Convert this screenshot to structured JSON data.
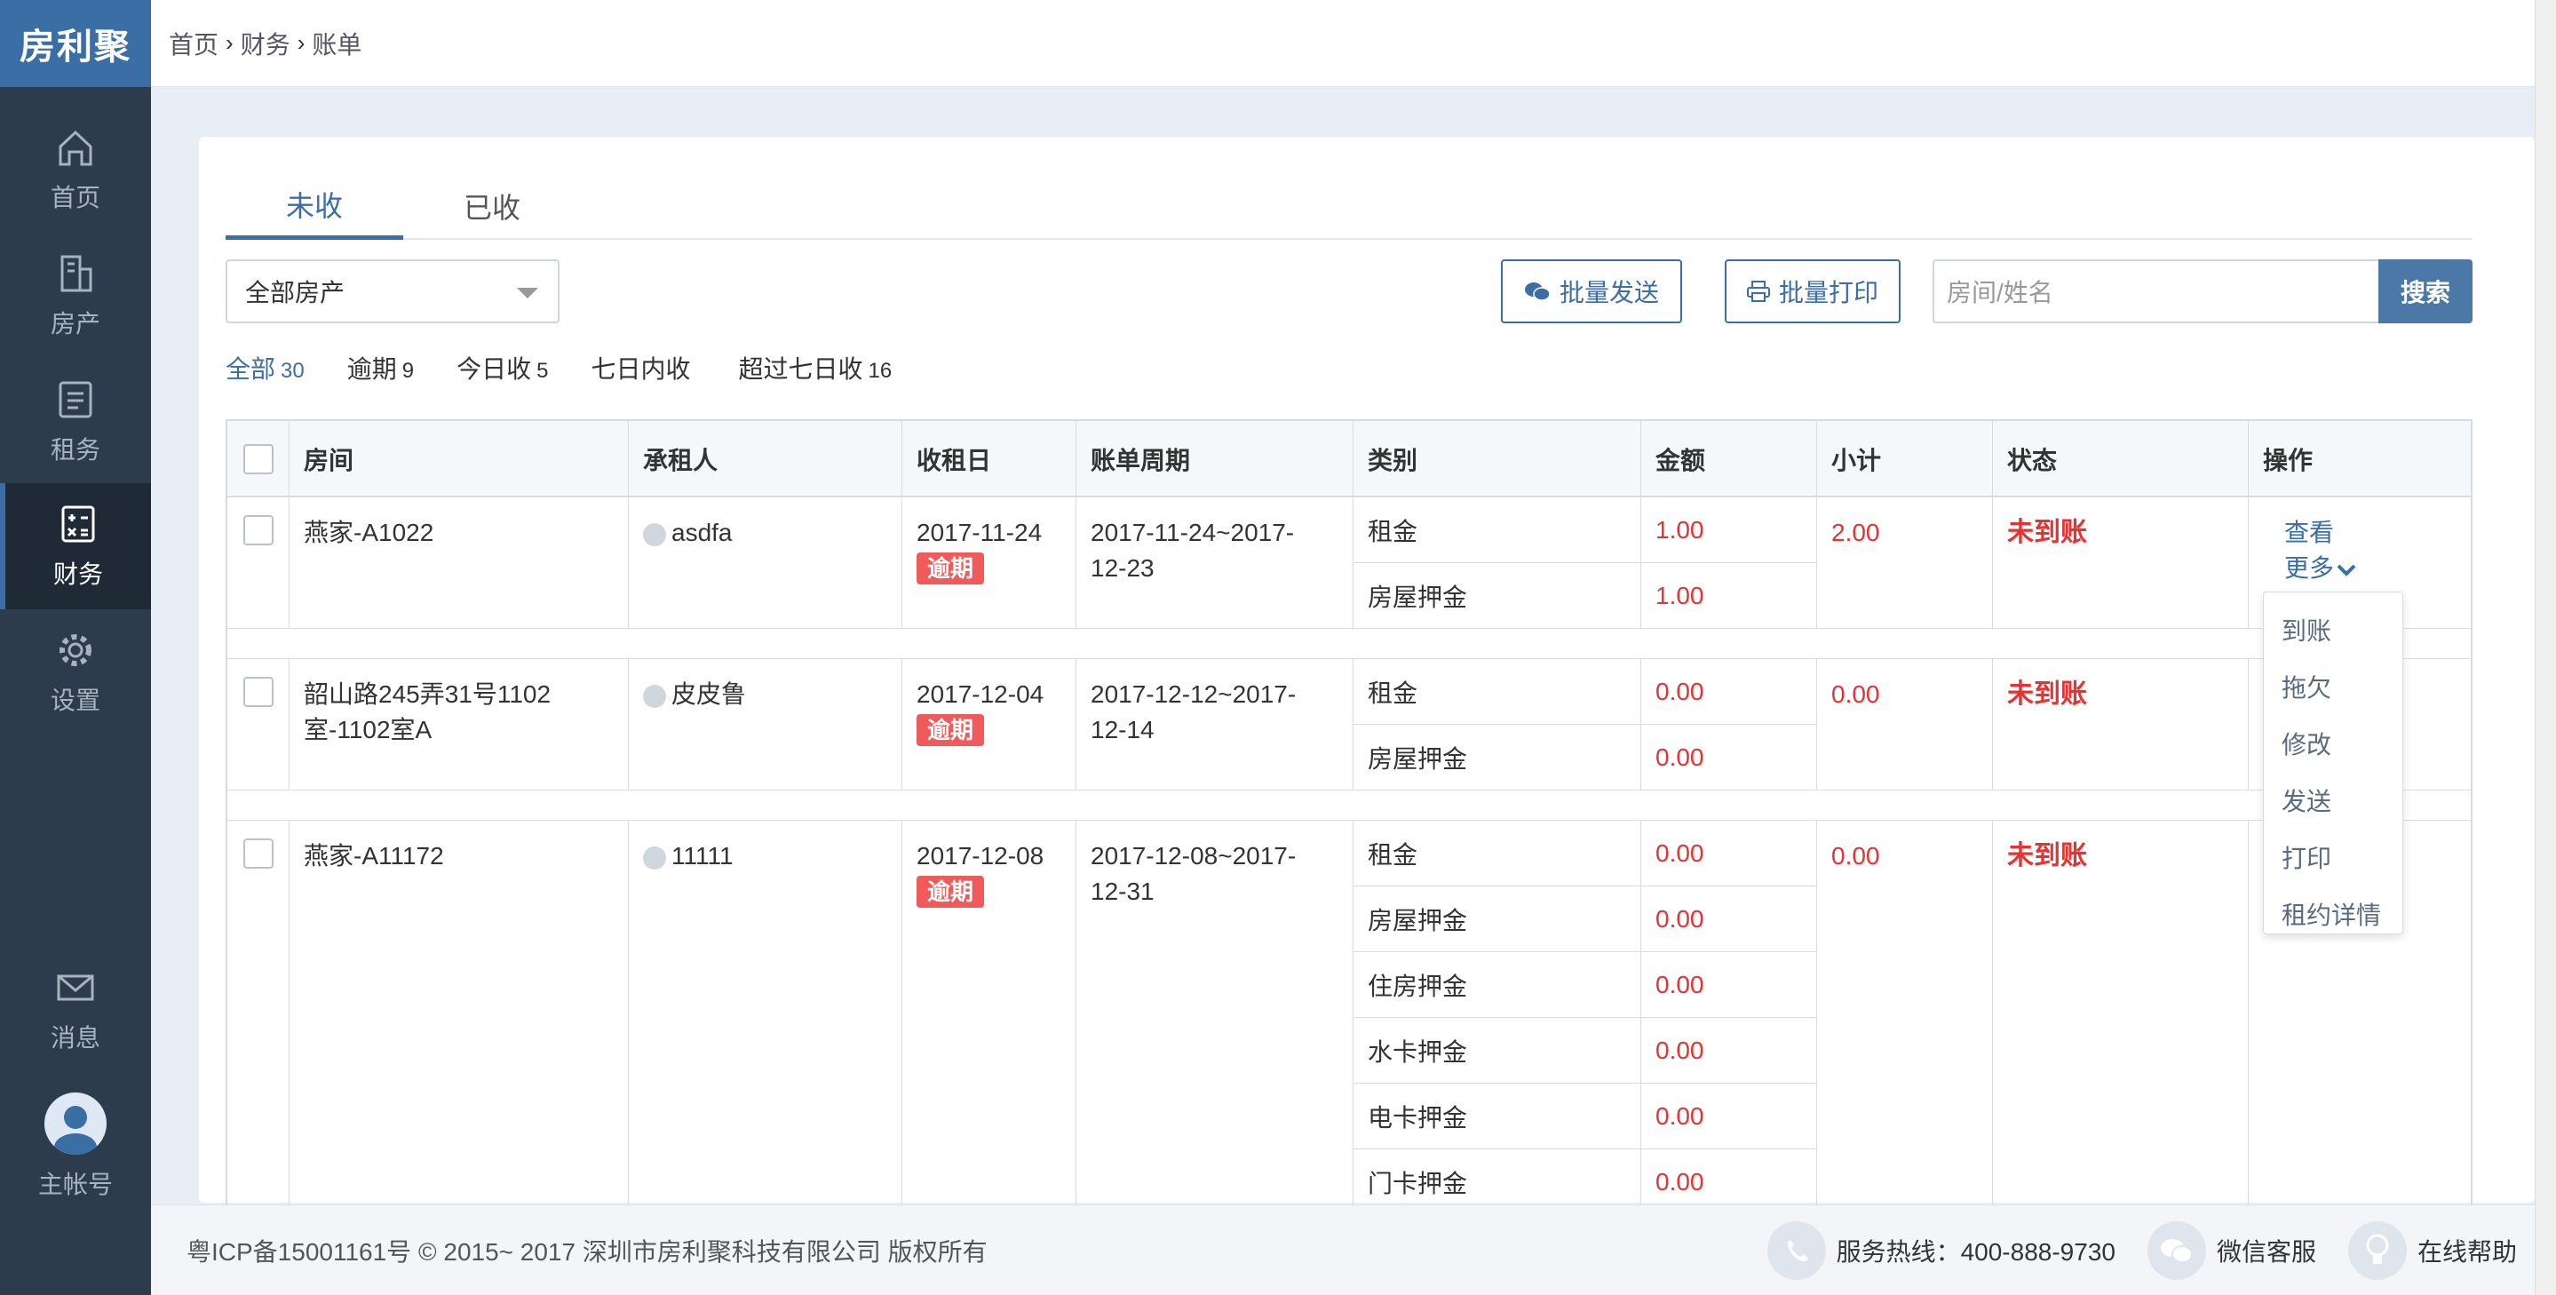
{
  "app": {
    "logo": "房利聚"
  },
  "breadcrumb": [
    "首页",
    "财务",
    "账单"
  ],
  "sidebar": {
    "items": [
      {
        "label": "首页",
        "icon": "home-icon"
      },
      {
        "label": "房产",
        "icon": "building-icon"
      },
      {
        "label": "租务",
        "icon": "lease-icon"
      },
      {
        "label": "财务",
        "icon": "finance-icon",
        "active": true
      },
      {
        "label": "设置",
        "icon": "gear-icon"
      },
      {
        "label": "消息",
        "icon": "mail-icon"
      },
      {
        "label": "主帐号",
        "icon": "avatar-icon"
      }
    ]
  },
  "tabs": [
    {
      "label": "未收",
      "active": true
    },
    {
      "label": "已收"
    }
  ],
  "property_select": {
    "value": "全部房产"
  },
  "toolbar": {
    "batch_send": "批量发送",
    "batch_print": "批量打印",
    "search_placeholder": "房间/姓名",
    "search_button": "搜索"
  },
  "filters": [
    {
      "label": "全部",
      "count": "30",
      "active": true
    },
    {
      "label": "逾期",
      "count": "9"
    },
    {
      "label": "今日收",
      "count": "5"
    },
    {
      "label": "七日内收",
      "count": ""
    },
    {
      "label": "超过七日收",
      "count": "16"
    }
  ],
  "table": {
    "headers": [
      "房间",
      "承租人",
      "收租日",
      "账单周期",
      "类别",
      "金额",
      "小计",
      "状态",
      "操作"
    ],
    "rows": [
      {
        "room_line1": "燕家-A1022",
        "room_line2": "",
        "tenant": "asdfa",
        "due_date": "2017-11-24",
        "overdue": "逾期",
        "period_line1": "2017-11-24~2017-",
        "period_line2": "12-23",
        "items": [
          {
            "type": "租金",
            "amount": "1.00"
          },
          {
            "type": "房屋押金",
            "amount": "1.00"
          }
        ],
        "subtotal": "2.00",
        "status": "未到账",
        "ops": {
          "view": "查看",
          "more": "更多"
        }
      },
      {
        "room_line1": "韶山路245弄31号1102",
        "room_line2": "室-1102室A",
        "tenant": "皮皮鲁",
        "due_date": "2017-12-04",
        "overdue": "逾期",
        "period_line1": "2017-12-12~2017-",
        "period_line2": "12-14",
        "items": [
          {
            "type": "租金",
            "amount": "0.00"
          },
          {
            "type": "房屋押金",
            "amount": "0.00"
          }
        ],
        "subtotal": "0.00",
        "status": "未到账"
      },
      {
        "room_line1": "燕家-A11172",
        "room_line2": "",
        "tenant": "11111",
        "due_date": "2017-12-08",
        "overdue": "逾期",
        "period_line1": "2017-12-08~2017-",
        "period_line2": "12-31",
        "items": [
          {
            "type": "租金",
            "amount": "0.00"
          },
          {
            "type": "房屋押金",
            "amount": "0.00"
          },
          {
            "type": "住房押金",
            "amount": "0.00"
          },
          {
            "type": "水卡押金",
            "amount": "0.00"
          },
          {
            "type": "电卡押金",
            "amount": "0.00"
          },
          {
            "type": "门卡押金",
            "amount": "0.00"
          }
        ],
        "subtotal": "0.00",
        "status": "未到账"
      }
    ]
  },
  "more_menu": [
    "到账",
    "拖欠",
    "修改",
    "发送",
    "打印",
    "租约详情"
  ],
  "footer": {
    "copyright": "粤ICP备15001161号 © 2015~ 2017 深圳市房利聚科技有限公司 版权所有",
    "hotline": "服务热线：400-888-9730",
    "wechat": "微信客服",
    "help": "在线帮助"
  },
  "colors": {
    "primary": "#3a6ea5",
    "sidebar": "#2d3c4c",
    "danger": "#e53333"
  }
}
